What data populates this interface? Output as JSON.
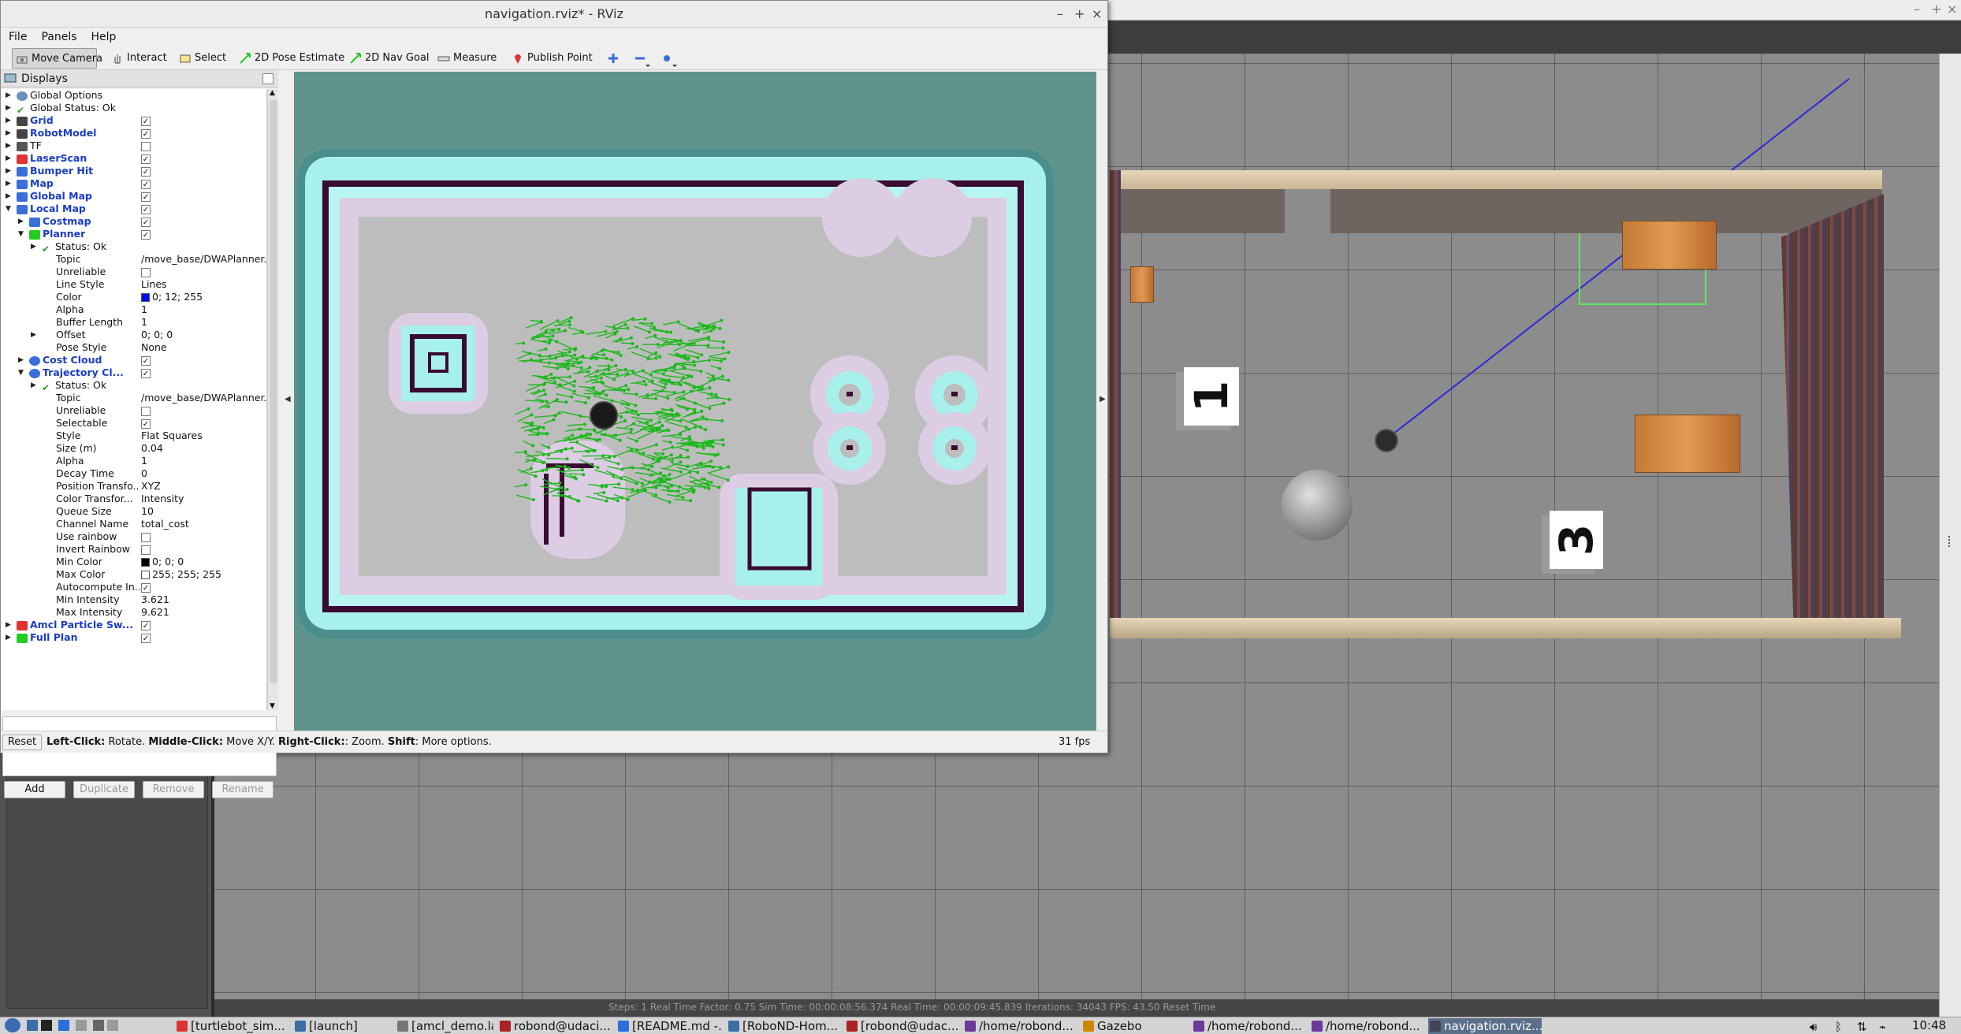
{
  "rviz": {
    "title": "navigation.rviz* - RViz",
    "window_controls": {
      "minimize": "–",
      "maximize": "+",
      "close": "×"
    },
    "menu": [
      "File",
      "Panels",
      "Help"
    ],
    "toolbar": [
      {
        "label": "Move Camera",
        "icon": "camera-icon"
      },
      {
        "label": "Interact",
        "icon": "hand-icon"
      },
      {
        "label": "Select",
        "icon": "select-icon"
      },
      {
        "label": "2D Pose Estimate",
        "icon": "pose-arrow-icon"
      },
      {
        "label": "2D Nav Goal",
        "icon": "goal-arrow-icon"
      },
      {
        "label": "Measure",
        "icon": "ruler-icon"
      },
      {
        "label": "Publish Point",
        "icon": "pin-icon"
      }
    ],
    "displays": {
      "title": "Displays",
      "items": [
        {
          "label": "Global Options",
          "value": "",
          "depth": 0,
          "expand": "right",
          "icon": "gear-icon"
        },
        {
          "label": "Global Status: Ok",
          "value": "",
          "depth": 0,
          "expand": "right",
          "icon": "check-icon"
        },
        {
          "label": "Grid",
          "value": "",
          "depth": 0,
          "expand": "right",
          "icon": "grid-icon",
          "blue": true,
          "checked": true
        },
        {
          "label": "RobotModel",
          "value": "",
          "depth": 0,
          "expand": "right",
          "icon": "robot-icon",
          "blue": true,
          "checked": true
        },
        {
          "label": "TF",
          "value": "",
          "depth": 0,
          "expand": "right",
          "icon": "tf-icon",
          "checked": false
        },
        {
          "label": "LaserScan",
          "value": "",
          "depth": 0,
          "expand": "right",
          "icon": "laser-icon",
          "blue": true,
          "checked": true
        },
        {
          "label": "Bumper Hit",
          "value": "",
          "depth": 0,
          "expand": "right",
          "icon": "dots-icon",
          "blue": true,
          "checked": true
        },
        {
          "label": "Map",
          "value": "",
          "depth": 0,
          "expand": "right",
          "icon": "map-icon",
          "blue": true,
          "checked": true
        },
        {
          "label": "Global Map",
          "value": "",
          "depth": 0,
          "expand": "right",
          "icon": "folder-icon",
          "blue": true,
          "checked": true
        },
        {
          "label": "Local Map",
          "value": "",
          "depth": 0,
          "expand": "down",
          "icon": "folder-icon",
          "blue": true,
          "checked": true
        },
        {
          "label": "Costmap",
          "value": "",
          "depth": 1,
          "expand": "right",
          "icon": "map-icon",
          "blue": true,
          "checked": true
        },
        {
          "label": "Planner",
          "value": "",
          "depth": 1,
          "expand": "down",
          "icon": "path-icon",
          "blue": true,
          "checked": true
        },
        {
          "label": "Status: Ok",
          "value": "",
          "depth": 2,
          "expand": "right",
          "icon": "check-icon"
        },
        {
          "label": "Topic",
          "value": "/move_base/DWAPlanner...",
          "depth": 2
        },
        {
          "label": "Unreliable",
          "value": "",
          "depth": 2,
          "checked": false
        },
        {
          "label": "Line Style",
          "value": "Lines",
          "depth": 2
        },
        {
          "label": "Color",
          "value": "0; 12; 255",
          "depth": 2,
          "swatch": "#000cff"
        },
        {
          "label": "Alpha",
          "value": "1",
          "depth": 2
        },
        {
          "label": "Buffer Length",
          "value": "1",
          "depth": 2
        },
        {
          "label": "Offset",
          "value": "0; 0; 0",
          "depth": 2,
          "expand": "right"
        },
        {
          "label": "Pose Style",
          "value": "None",
          "depth": 2
        },
        {
          "label": "Cost Cloud",
          "value": "",
          "depth": 1,
          "expand": "right",
          "icon": "cloud-icon",
          "blue": true,
          "checked": true
        },
        {
          "label": "Trajectory Cl...",
          "value": "",
          "depth": 1,
          "expand": "down",
          "icon": "cloud-icon",
          "blue": true,
          "checked": true
        },
        {
          "label": "Status: Ok",
          "value": "",
          "depth": 2,
          "expand": "right",
          "icon": "check-icon"
        },
        {
          "label": "Topic",
          "value": "/move_base/DWAPlanner...",
          "depth": 2
        },
        {
          "label": "Unreliable",
          "value": "",
          "depth": 2,
          "checked": false
        },
        {
          "label": "Selectable",
          "value": "",
          "depth": 2,
          "checked": true
        },
        {
          "label": "Style",
          "value": "Flat Squares",
          "depth": 2
        },
        {
          "label": "Size (m)",
          "value": "0.04",
          "depth": 2
        },
        {
          "label": "Alpha",
          "value": "1",
          "depth": 2
        },
        {
          "label": "Decay Time",
          "value": "0",
          "depth": 2
        },
        {
          "label": "Position Transfo...",
          "value": "XYZ",
          "depth": 2
        },
        {
          "label": "Color Transfor...",
          "value": "Intensity",
          "depth": 2
        },
        {
          "label": "Queue Size",
          "value": "10",
          "depth": 2
        },
        {
          "label": "Channel Name",
          "value": "total_cost",
          "depth": 2
        },
        {
          "label": "Use rainbow",
          "value": "",
          "depth": 2,
          "checked": false
        },
        {
          "label": "Invert Rainbow",
          "value": "",
          "depth": 2,
          "checked": false
        },
        {
          "label": "Min Color",
          "value": "0; 0; 0",
          "depth": 2,
          "swatch": "#000000"
        },
        {
          "label": "Max Color",
          "value": "255; 255; 255",
          "depth": 2,
          "swatch": "#ffffff"
        },
        {
          "label": "Autocompute In...",
          "value": "",
          "depth": 2,
          "checked": true
        },
        {
          "label": "Min Intensity",
          "value": "3.621",
          "depth": 2
        },
        {
          "label": "Max Intensity",
          "value": "9.621",
          "depth": 2
        },
        {
          "label": "Amcl Particle Sw...",
          "value": "",
          "depth": 0,
          "expand": "right",
          "icon": "particle-icon",
          "blue": true,
          "checked": true
        },
        {
          "label": "Full Plan",
          "value": "",
          "depth": 0,
          "expand": "right",
          "icon": "path-icon",
          "blue": true,
          "checked": true
        }
      ]
    },
    "buttons": {
      "add": "Add",
      "duplicate": "Duplicate",
      "remove": "Remove",
      "rename": "Rename"
    },
    "status_bar": {
      "reset": "Reset",
      "hint_parts": [
        {
          "text": "Left-Click:",
          "bold": true
        },
        {
          "text": " Rotate. ",
          "bold": false
        },
        {
          "text": "Middle-Click:",
          "bold": true
        },
        {
          "text": " Move X/Y. ",
          "bold": false
        },
        {
          "text": "Right-Click:",
          "bold": true
        },
        {
          "text": ": Zoom. ",
          "bold": false
        },
        {
          "text": "Shift",
          "bold": true
        },
        {
          "text": ": More options.",
          "bold": false
        }
      ],
      "fps": "31 fps"
    }
  },
  "gazebo": {
    "marker_1": "1",
    "marker_3": "3",
    "bottom_bar": "Steps: 1    Real Time Factor: 0.75    Sim Time: 00:00:08:56.374    Real Time: 00:00:09:45.839    Iterations: 34043    FPS: 43.50    Reset Time"
  },
  "taskbar": {
    "tasks": [
      {
        "label": "[turtlebot_sim...",
        "icon": "chrome-icon",
        "color": "#d33"
      },
      {
        "label": "[launch]",
        "icon": "folder-icon",
        "color": "#3a6ea5"
      },
      {
        "label": "[amcl_demo.la...",
        "icon": "editor-icon",
        "color": "#777"
      },
      {
        "label": "robond@udaci...",
        "icon": "terminal-icon",
        "color": "#a22"
      },
      {
        "label": "[README.md -...",
        "icon": "vscode-icon",
        "color": "#2a6fdb"
      },
      {
        "label": "[RoboND-Hom...",
        "icon": "folder-icon",
        "color": "#3a6ea5"
      },
      {
        "label": "[robond@udac...",
        "icon": "terminal-icon",
        "color": "#a22"
      },
      {
        "label": "/home/robond...",
        "icon": "x-icon",
        "color": "#6a3a9a"
      },
      {
        "label": "Gazebo",
        "icon": "gazebo-icon",
        "color": "#c80"
      },
      {
        "label": "/home/robond...",
        "icon": "x-icon",
        "color": "#6a3a9a"
      },
      {
        "label": "/home/robond...",
        "icon": "x-icon",
        "color": "#6a3a9a"
      },
      {
        "label": "navigation.rviz...",
        "icon": "rviz-icon",
        "color": "#445",
        "active": true
      }
    ],
    "clock": "10:48"
  }
}
